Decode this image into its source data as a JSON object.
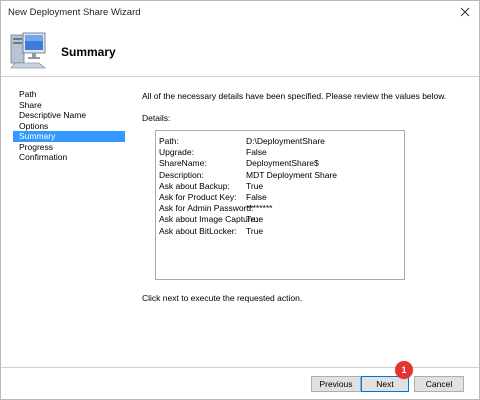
{
  "window": {
    "title": "New Deployment Share Wizard"
  },
  "header": {
    "title": "Summary",
    "icon": "computer-icon"
  },
  "steps": [
    {
      "label": "Path",
      "active": false
    },
    {
      "label": "Share",
      "active": false
    },
    {
      "label": "Descriptive Name",
      "active": false
    },
    {
      "label": "Options",
      "active": false
    },
    {
      "label": "Summary",
      "active": true
    },
    {
      "label": "Progress",
      "active": false
    },
    {
      "label": "Confirmation",
      "active": false
    }
  ],
  "main": {
    "intro": "All of the necessary details have been specified.  Please review the values below.",
    "details_label": "Details:",
    "details": [
      {
        "key": "Path:",
        "value": "D:\\DeploymentShare"
      },
      {
        "key": "Upgrade:",
        "value": "False"
      },
      {
        "key": "ShareName:",
        "value": "DeploymentShare$"
      },
      {
        "key": "Description:",
        "value": "MDT Deployment Share"
      },
      {
        "key": "Ask about Backup:",
        "value": "True"
      },
      {
        "key": "Ask for Product Key:",
        "value": "False"
      },
      {
        "key": "Ask for Admin Password:",
        "value": "********"
      },
      {
        "key": "Ask about Image Capture:",
        "value": "True"
      },
      {
        "key": "Ask about BitLocker:",
        "value": "True"
      }
    ],
    "footer": "Click next to execute the requested action."
  },
  "buttons": {
    "previous": "Previous",
    "next": "Next",
    "cancel": "Cancel"
  },
  "marker": "1",
  "colors": {
    "selection": "#3399ff",
    "marker": "#e3342f",
    "default_button_border": "#0078d7"
  }
}
